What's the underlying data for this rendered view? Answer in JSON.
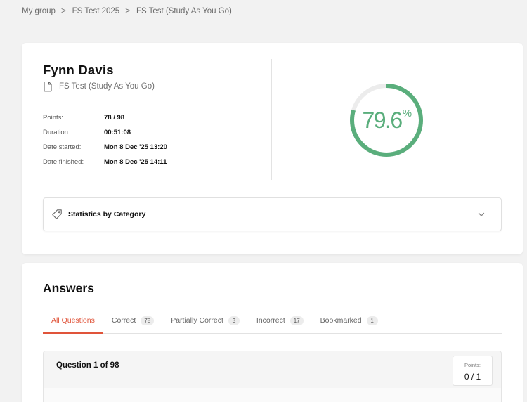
{
  "breadcrumb": {
    "items": [
      "My group",
      "FS Test 2025",
      "FS Test (Study As You Go)"
    ],
    "separator": ">"
  },
  "summary": {
    "student_name": "Fynn Davis",
    "test_name": "FS Test (Study As You Go)",
    "stats": [
      {
        "label": "Points:",
        "value": "78 / 98"
      },
      {
        "label": "Duration:",
        "value": "00:51:08"
      },
      {
        "label": "Date started:",
        "value": "Mon 8 Dec '25 13:20"
      },
      {
        "label": "Date finished:",
        "value": "Mon 8 Dec '25 14:11"
      }
    ],
    "score_value": "79.6",
    "score_unit": "%",
    "score_fraction": 0.796,
    "score_color": "#5aae7c",
    "statistics_by_category_label": "Statistics by Category"
  },
  "answers": {
    "title": "Answers",
    "tabs": [
      {
        "label": "All Questions",
        "count": ""
      },
      {
        "label": "Correct",
        "count": "78"
      },
      {
        "label": "Partially Correct",
        "count": "3"
      },
      {
        "label": "Incorrect",
        "count": "17"
      },
      {
        "label": "Bookmarked",
        "count": "1"
      }
    ],
    "active_tab_color": "#e0543a",
    "question_title": "Question 1 of 98",
    "points_label": "Points:",
    "points_value": "0 / 1"
  }
}
